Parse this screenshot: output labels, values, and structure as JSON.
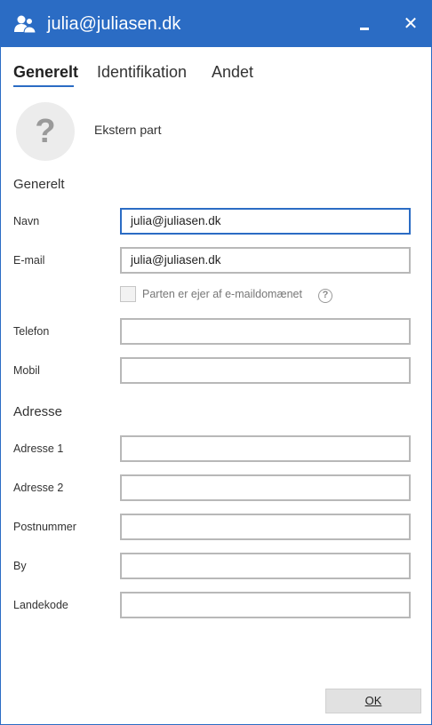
{
  "window": {
    "title": "julia@juliasen.dk",
    "app_icon": "people-icon",
    "close_glyph": "✕"
  },
  "tabs": [
    {
      "label": "Generelt",
      "active": true
    },
    {
      "label": "Identifikation",
      "active": false
    },
    {
      "label": "Andet",
      "active": false
    }
  ],
  "header": {
    "avatar_glyph": "?",
    "party_type": "Ekstern part"
  },
  "general": {
    "heading": "Generelt",
    "name_label": "Navn",
    "name_value": "julia@juliasen.dk",
    "email_label": "E-mail",
    "email_value": "julia@juliasen.dk",
    "domain_owner_label": "Parten er ejer af e-maildomænet",
    "domain_owner_checked": false,
    "help_glyph": "?",
    "phone_label": "Telefon",
    "phone_value": "",
    "mobile_label": "Mobil",
    "mobile_value": ""
  },
  "address": {
    "heading": "Adresse",
    "address1_label": "Adresse 1",
    "address1_value": "",
    "address2_label": "Adresse 2",
    "address2_value": "",
    "postal_label": "Postnummer",
    "postal_value": "",
    "city_label": "By",
    "city_value": "",
    "country_label": "Landekode",
    "country_value": ""
  },
  "footer": {
    "ok_label": "OK"
  },
  "colors": {
    "accent": "#2b6cc4",
    "button_bg": "#e1e1e1"
  }
}
